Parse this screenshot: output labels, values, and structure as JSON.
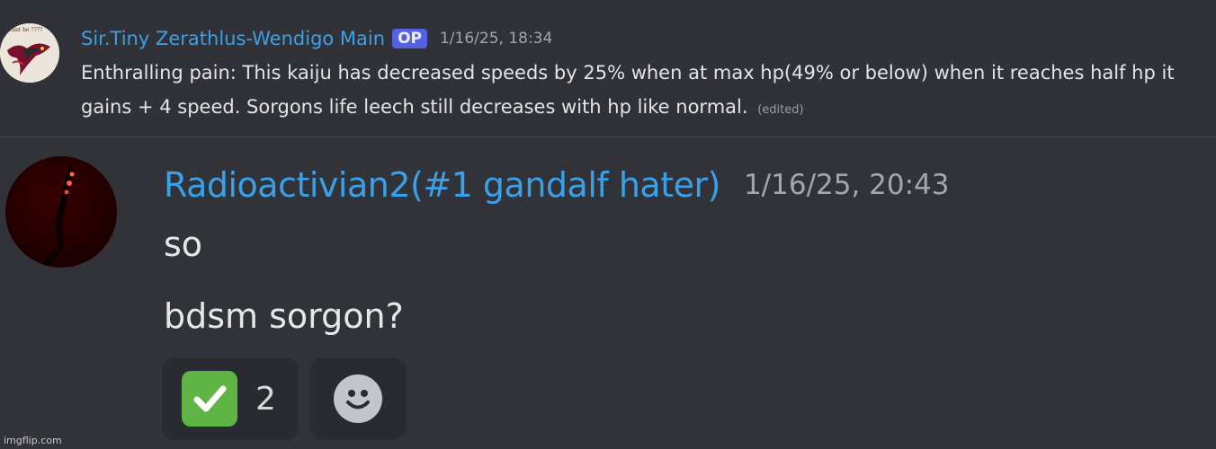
{
  "messages": [
    {
      "author": "Sir.Tiny Zerathlus-Wendigo Main",
      "badge": "OP",
      "timestamp": "1/16/25, 18:34",
      "text": "Enthralling pain: This kaiju has decreased speeds by 25% when at max hp(49% or below) when it reaches half hp it gains + 4 speed. Sorgons life leech still decreases with hp like normal.",
      "edited_label": "(edited)",
      "avatar_text": "cant be ????"
    },
    {
      "author": "Radioactivian2(#1 gandalf hater)",
      "timestamp": "1/16/25, 20:43",
      "lines": [
        "so",
        "bdsm sorgon?"
      ]
    }
  ],
  "reactions": [
    {
      "emoji": "check-mark-button",
      "count": "2"
    },
    {
      "emoji": "add-reaction-smiley"
    }
  ],
  "watermark": "imgflip.com",
  "colors": {
    "background": "#323339",
    "username": "#3aa1e8",
    "timestamp": "#a3a6ad",
    "badge": "#5865f2",
    "reaction_bg": "#2a2b30",
    "check_green": "#5fb544"
  }
}
